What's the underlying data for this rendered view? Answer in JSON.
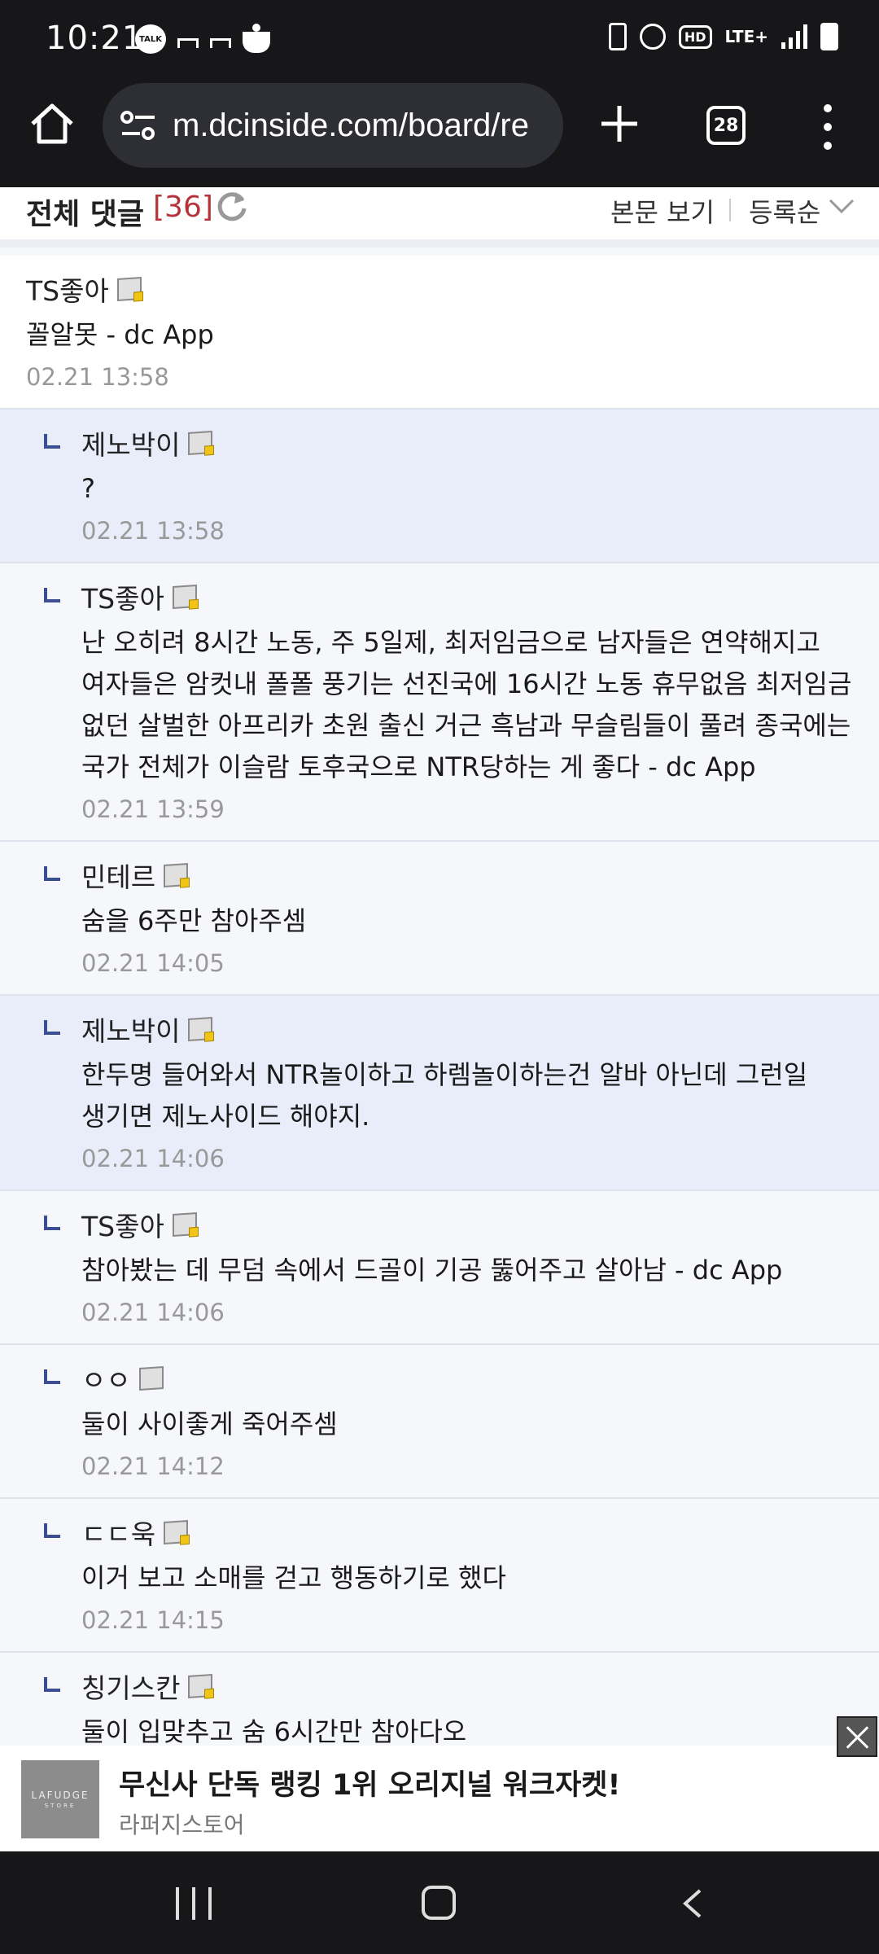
{
  "status_bar": {
    "time": "10:21",
    "talk_icon_text": "TALK",
    "hd_label": "HD",
    "network_label": "LTE+"
  },
  "browser": {
    "url": "m.dcinside.com/board/re",
    "tab_count": "28"
  },
  "comments_header": {
    "title": "전체 댓글",
    "count": "[36]",
    "view_post_label": "본문 보기",
    "sort_label": "등록순"
  },
  "comments": [
    {
      "nick": "TS좋아",
      "text": "꼴알못 - dc App",
      "date": "02.21 13:58"
    },
    {
      "nick": "제노박이",
      "text": "?",
      "date": "02.21 13:58"
    },
    {
      "nick": "TS좋아",
      "text": "난 오히려 8시간 노동, 주 5일제, 최저임금으로 남자들은 연약해지고 여자들은 암컷내 폴폴 풍기는 선진국에 16시간 노동 휴무없음 최저임금 없던 살벌한 아프리카 초원 출신 거근 흑남과 무슬림들이 풀려 종국에는 국가 전체가 이슬람 토후국으로 NTR당하는 게 좋다 - dc App",
      "date": "02.21 13:59"
    },
    {
      "nick": "민테르",
      "text": "숨을 6주만 참아주셈",
      "date": "02.21 14:05"
    },
    {
      "nick": "제노박이",
      "text": "한두명 들어와서 NTR놀이하고 하렘놀이하는건 알바 아닌데 그런일 생기면 제노사이드 해야지.",
      "date": "02.21 14:06"
    },
    {
      "nick": "TS좋아",
      "text": "참아봤는 데 무덤 속에서 드골이 기공 뚫어주고 살아남 - dc App",
      "date": "02.21 14:06"
    },
    {
      "nick": "ㅇㅇ",
      "text": "둘이 사이좋게 죽어주셈",
      "date": "02.21 14:12"
    },
    {
      "nick": "ㄷㄷ욱",
      "text": "이거 보고 소매를 걷고 행동하기로 했다",
      "date": "02.21 14:15"
    },
    {
      "nick": "칭기스칸",
      "text": "둘이 입맞추고 숨 6시간만 참아다오",
      "date": ""
    }
  ],
  "ad": {
    "logo_text": "LAFUDGE",
    "logo_sub": "STORE",
    "title": "무신사 단독 랭킹 1위 오리지널 워크자켓!",
    "store": "라퍼지스토어"
  }
}
